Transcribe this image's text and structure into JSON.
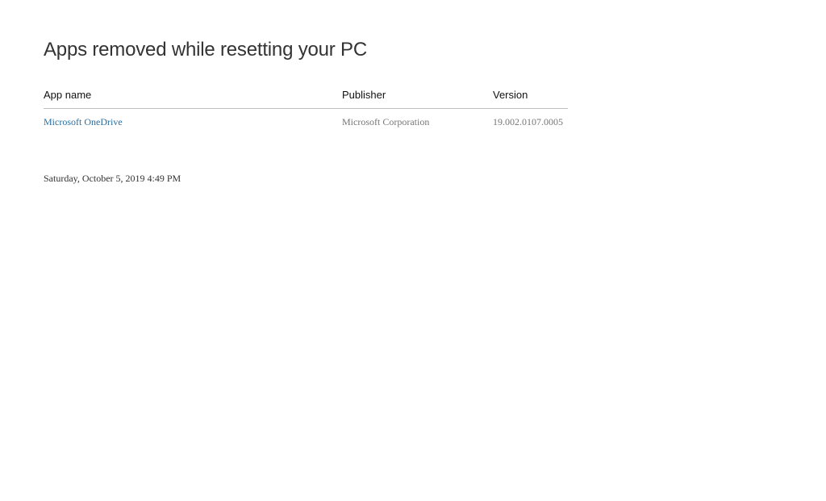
{
  "page": {
    "title": "Apps removed while resetting your PC",
    "timestamp": "Saturday, October 5, 2019 4:49 PM"
  },
  "table": {
    "headers": {
      "app_name": "App name",
      "publisher": "Publisher",
      "version": "Version"
    },
    "rows": [
      {
        "app_name": "Microsoft OneDrive",
        "publisher": "Microsoft Corporation",
        "version": "19.002.0107.0005"
      }
    ]
  },
  "colors": {
    "link": "#2b6e9e",
    "muted_text": "#767676",
    "header_rule": "#bdbdbd"
  }
}
